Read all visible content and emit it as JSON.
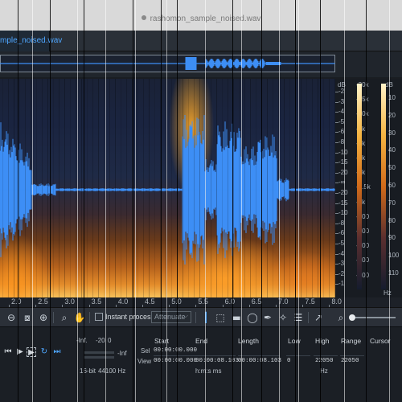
{
  "window": {
    "title": "rashomon_sample_noised.wav"
  },
  "tab": {
    "label": "mple_noised.wav"
  },
  "scales": {
    "db_header": "dB",
    "hz_header": "Hz",
    "db_header2": "dB",
    "db_ticks": [
      "-2",
      "-3",
      "-4",
      "-5",
      "-6",
      "-8",
      "-10",
      "-15",
      "-20",
      "-∞",
      "-20",
      "-15",
      "-10",
      "-8",
      "-6",
      "-5",
      "-4",
      "-3",
      "-2",
      "-1"
    ],
    "hz_ticks": [
      "-20k",
      "-15k",
      "-10k",
      "-7k",
      "-5k",
      "-3k",
      "-2k",
      "-1.5k",
      "-1k",
      "-700",
      "-500",
      "-300",
      "-200",
      "-100"
    ],
    "db_right_ticks": [
      "10",
      "20",
      "30",
      "40",
      "50",
      "60",
      "70",
      "80",
      "90",
      "100",
      "110"
    ]
  },
  "ruler": {
    "labels": [
      "2.0",
      "2.5",
      "3.0",
      "3.5",
      "4.0",
      "4.5",
      "5.0",
      "5.5",
      "6.0",
      "6.5",
      "7.0",
      "7.5",
      "8.0"
    ]
  },
  "toolbar": {
    "instant_process_label": "Instant process",
    "mode_value": "Attenuate"
  },
  "bottom": {
    "meter_inf": "-Inf.",
    "meter_minus20": "-20",
    "meter_zero": "0",
    "meter_inf2": "-Inf",
    "bit_depth": "16-bit",
    "sample_rate": "44100 Hz",
    "col_start": "Start",
    "col_end": "End",
    "col_length": "Length",
    "col_low": "Low",
    "col_high": "High",
    "col_range": "Range",
    "col_cursor": "Cursor",
    "row_sel": "Sel",
    "row_view": "View",
    "sel_start": "00:00:00.000",
    "view_start": "00:00:00.000",
    "view_end": "00:00:08.103",
    "view_length": "00:00:08.103",
    "view_low": "0",
    "view_high": "22050",
    "view_range": "22050",
    "time_format": "h:m:s ms",
    "freq_unit": "Hz"
  }
}
